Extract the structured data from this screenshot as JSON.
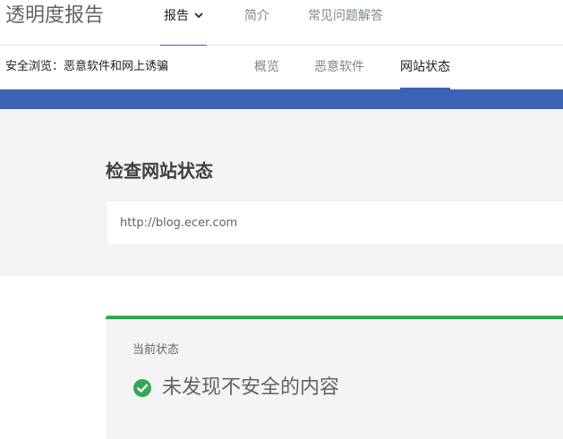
{
  "header": {
    "brand": "透明度报告",
    "tabs": [
      {
        "label": "报告",
        "active": true,
        "has_dropdown": true
      },
      {
        "label": "简介",
        "active": false
      },
      {
        "label": "常见问题解答",
        "active": false
      }
    ]
  },
  "subnav": {
    "section": "安全浏览：恶意软件和网上诱骗",
    "tabs": [
      {
        "label": "概览",
        "active": false
      },
      {
        "label": "恶意软件",
        "active": false
      },
      {
        "label": "网站状态",
        "active": true
      }
    ]
  },
  "check": {
    "title": "检查网站状态",
    "input_value": "http://blog.ecer.com"
  },
  "status": {
    "label": "当前状态",
    "text": "未发现不安全的内容",
    "icon": "check-circle-icon"
  },
  "colors": {
    "accent": "#3c64b4",
    "safe": "#34a853",
    "panel": "#f4f4f4"
  }
}
